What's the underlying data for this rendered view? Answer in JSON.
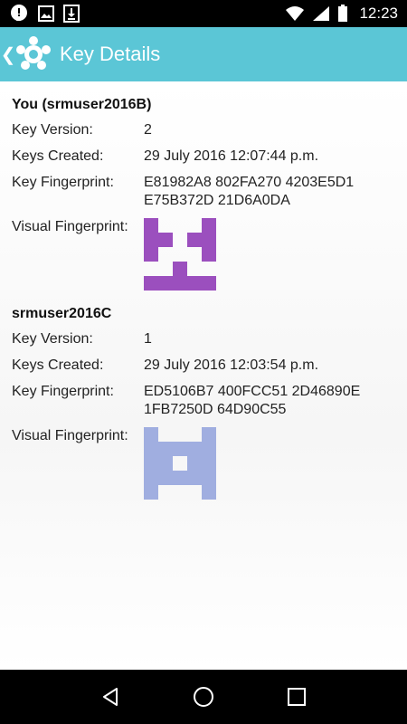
{
  "status_bar": {
    "time": "12:23",
    "icons": [
      "notification-icon",
      "image-icon",
      "download-icon",
      "wifi-icon",
      "signal-icon",
      "battery-icon"
    ]
  },
  "app_bar": {
    "title": "Key Details",
    "back_glyph": "❮",
    "background": "#5bc6d6"
  },
  "keys": [
    {
      "name": "You (srmuser2016B)",
      "version_label": "Key Version:",
      "version": "2",
      "created_label": "Keys Created:",
      "created": "29 July 2016 12:07:44 p.m.",
      "fingerprint_label": "Key Fingerprint:",
      "fingerprint": "E81982A8 802FA270 4203E5D1 E75B372D 21D6A0DA",
      "visual_label": "Visual Fingerprint:",
      "visual_color": "#9b4fbe",
      "visual_grid": [
        [
          1,
          0,
          0,
          0,
          1
        ],
        [
          1,
          1,
          0,
          1,
          1
        ],
        [
          1,
          0,
          0,
          0,
          1
        ],
        [
          0,
          0,
          1,
          0,
          0
        ],
        [
          1,
          1,
          1,
          1,
          1
        ]
      ]
    },
    {
      "name": "srmuser2016C",
      "version_label": "Key Version:",
      "version": "1",
      "created_label": "Keys Created:",
      "created": "29 July 2016 12:03:54 p.m.",
      "fingerprint_label": "Key Fingerprint:",
      "fingerprint": "ED5106B7 400FCC51 2D46890E 1FB7250D 64D90C55",
      "visual_label": "Visual Fingerprint:",
      "visual_color": "#a0aee0",
      "visual_grid": [
        [
          1,
          0,
          0,
          0,
          1
        ],
        [
          1,
          1,
          1,
          1,
          1
        ],
        [
          1,
          1,
          0,
          1,
          1
        ],
        [
          1,
          1,
          1,
          1,
          1
        ],
        [
          1,
          0,
          0,
          0,
          1
        ]
      ]
    }
  ],
  "nav_bar": {
    "buttons": [
      "back-triangle-icon",
      "home-circle-icon",
      "recents-square-icon"
    ]
  }
}
